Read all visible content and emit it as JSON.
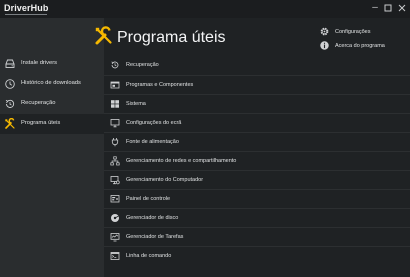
{
  "window": {
    "app_name": "DriverHub",
    "controls": [
      "minimize",
      "maximize",
      "close"
    ]
  },
  "sidebar": {
    "items": [
      {
        "label": "Instale drivers",
        "icon": "drive-install-icon",
        "active": false
      },
      {
        "label": "Histórico de downloads",
        "icon": "history-clock-icon",
        "active": false
      },
      {
        "label": "Recuperação",
        "icon": "restore-icon",
        "active": false
      },
      {
        "label": "Programa úteis",
        "icon": "tools-icon",
        "active": true
      }
    ]
  },
  "header": {
    "title": "Programa úteis",
    "icon": "tools-icon",
    "accent_color": "#f5b800"
  },
  "top_links": [
    {
      "label": "Configurações",
      "icon": "gear-icon"
    },
    {
      "label": "Acerca do programa",
      "icon": "info-icon"
    }
  ],
  "utilities": [
    {
      "label": "Recuperação",
      "icon": "restore-icon"
    },
    {
      "label": "Programas e Componentes",
      "icon": "programs-icon"
    },
    {
      "label": "Sistema",
      "icon": "windows-icon"
    },
    {
      "label": "Configurações do ecrã",
      "icon": "display-icon"
    },
    {
      "label": "Fonte de alimentação",
      "icon": "power-plug-icon"
    },
    {
      "label": "Gerenciamento de redes e compartilhamento",
      "icon": "network-icon"
    },
    {
      "label": "Gerenciamento do Computador",
      "icon": "computer-management-icon"
    },
    {
      "label": "Painel de controle",
      "icon": "control-panel-icon"
    },
    {
      "label": "Gerenciador de disco",
      "icon": "disk-icon"
    },
    {
      "label": "Gerenciador de Tarefas",
      "icon": "task-manager-icon"
    },
    {
      "label": "Linha de comando",
      "icon": "command-line-icon"
    }
  ]
}
